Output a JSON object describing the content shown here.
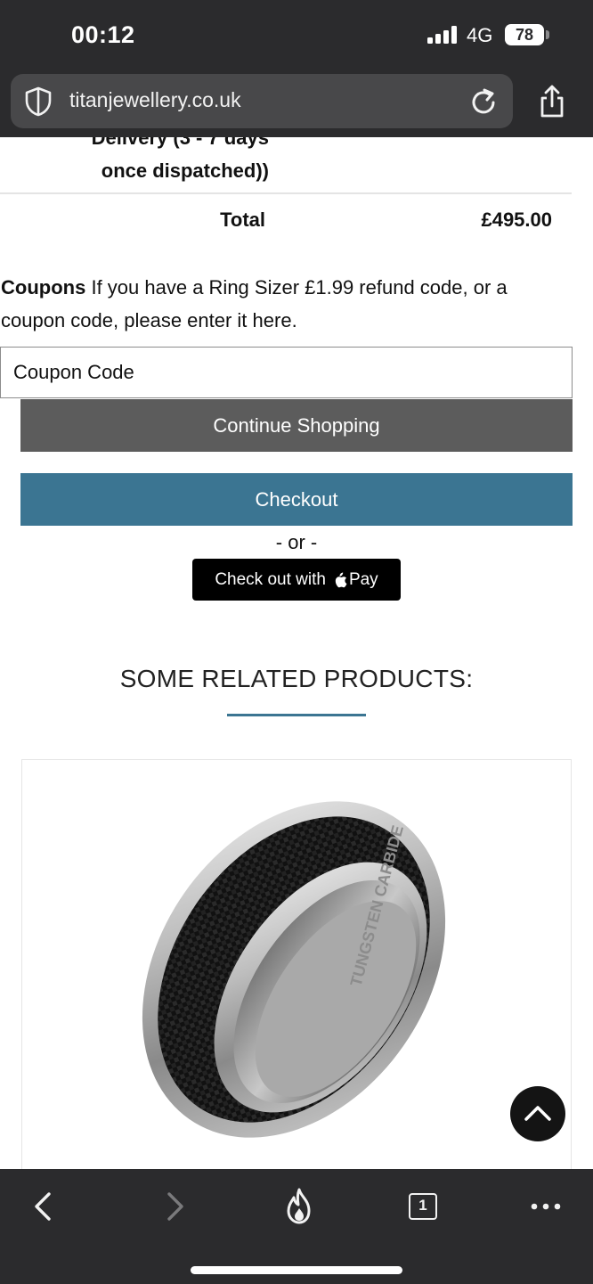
{
  "status_bar": {
    "time": "00:12",
    "network": "4G",
    "battery": "78"
  },
  "browser": {
    "url": "titanjewellery.co.uk"
  },
  "cart": {
    "delivery_label_line1": "Delivery (3 - 7 days",
    "delivery_label_line2": "once dispatched))",
    "total_label": "Total",
    "total_value": "£495.00"
  },
  "coupons": {
    "title": "Coupons",
    "description": "If you have a Ring Sizer £1.99 refund code, or a coupon code, please enter it here.",
    "input_placeholder": "Coupon Code"
  },
  "actions": {
    "continue_label": "Continue Shopping",
    "checkout_label": "Checkout",
    "or_label": "- or -",
    "applepay_prefix": "Check out with",
    "applepay_suffix": "Pay"
  },
  "related": {
    "heading": "SOME RELATED PRODUCTS:",
    "product_engraving": "TUNGSTEN CARBIDE"
  },
  "colors": {
    "chrome_background": "#2b2b2d",
    "continue_button": "#5c5c5c",
    "checkout_button": "#3b7592",
    "accent_rule": "#3b7592"
  },
  "icons": {
    "site_security": "shield-icon",
    "reload": "reload-icon",
    "share": "share-icon",
    "back": "chevron-left-icon",
    "forward": "chevron-right-icon",
    "fire": "fire-icon",
    "tabs": "tabs-icon",
    "more": "more-icon",
    "scroll_top": "arrow-up-icon"
  },
  "toolbar": {
    "tab_count": "1"
  }
}
